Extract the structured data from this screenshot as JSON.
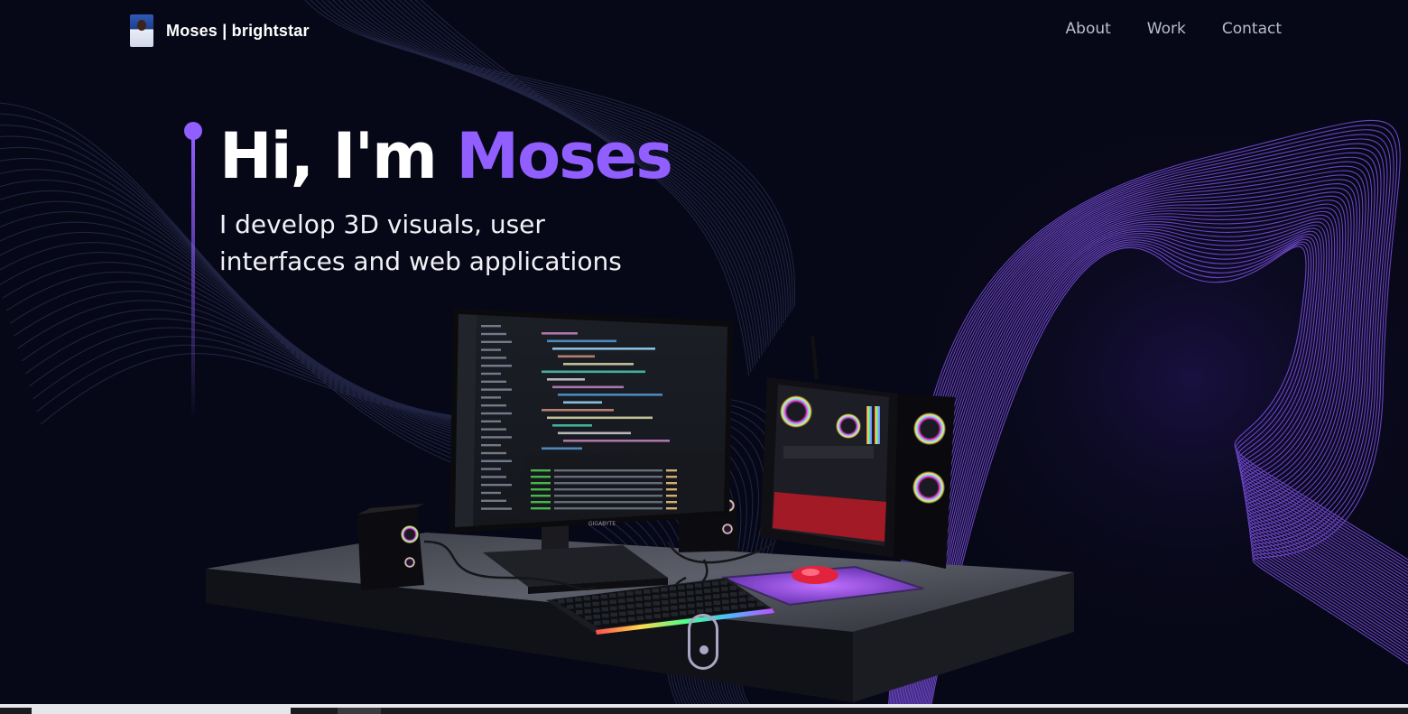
{
  "nav": {
    "brand_name": "Moses",
    "brand_suffix": " | brightstar",
    "links": [
      "About",
      "Work",
      "Contact"
    ]
  },
  "hero": {
    "title_prefix": "Hi, I'm ",
    "title_accent": "Moses",
    "subtitle_line1": "I develop 3D visuals, user",
    "subtitle_line2": "interfaces and web applications"
  },
  "colors": {
    "background": "#070817",
    "accent": "#915eff",
    "nav_text": "#b9bdcc"
  },
  "scene": {
    "monitor_brand": "GIGABYTE",
    "icons": [
      "computer-desk-3d-model",
      "scroll-down-icon"
    ]
  }
}
